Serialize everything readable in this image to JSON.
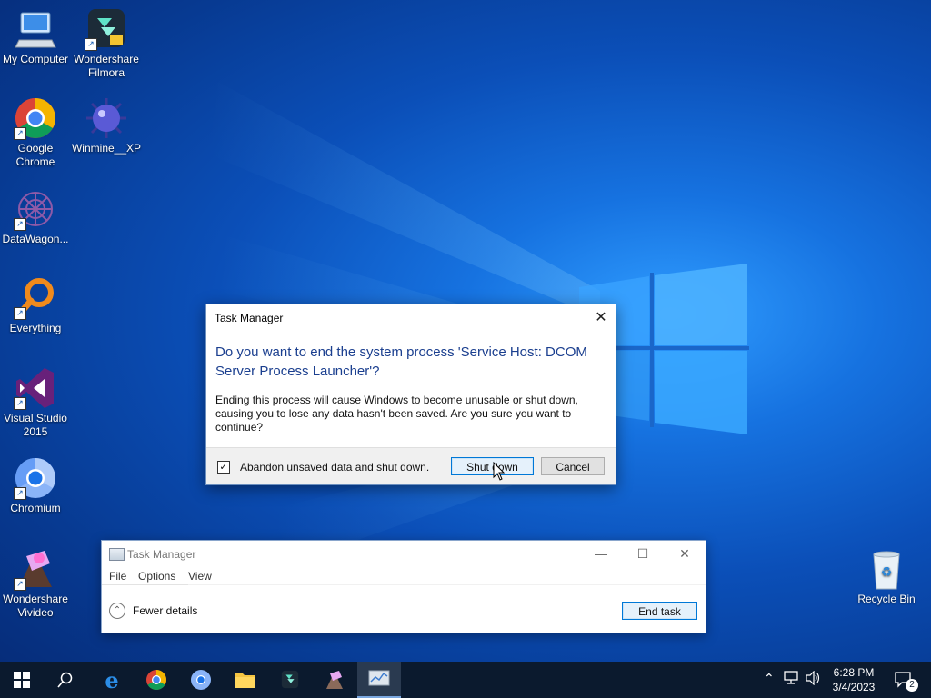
{
  "desktop": {
    "icons": [
      {
        "label": "My Computer",
        "icon": "computer-icon"
      },
      {
        "label": "Wondershare Filmora",
        "icon": "filmora-icon"
      },
      {
        "label": "Google Chrome",
        "icon": "chrome-icon"
      },
      {
        "label": "Winmine__XP",
        "icon": "mine-icon"
      },
      {
        "label": "DataWagon...",
        "icon": "datawagon-icon"
      },
      {
        "label": "Everything",
        "icon": "search-magnifier-icon"
      },
      {
        "label": "Visual Studio 2015",
        "icon": "visual-studio-icon"
      },
      {
        "label": "Chromium",
        "icon": "chromium-icon"
      },
      {
        "label": "Wondershare Vivideo",
        "icon": "vivideo-icon"
      },
      {
        "label": "Recycle Bin",
        "icon": "recycle-bin-icon"
      }
    ]
  },
  "dialog": {
    "title": "Task Manager",
    "question": "Do you want to end the system process 'Service Host: DCOM Server Process Launcher'?",
    "message": "Ending this process will cause Windows to become unusable or shut down, causing you to lose any data hasn't been saved. Are you sure you want to continue?",
    "checkbox_label": "Abandon unsaved data and shut down.",
    "checkbox_checked": true,
    "primary_button": "Shut down",
    "cancel_button": "Cancel",
    "close_glyph": "✕"
  },
  "task_manager": {
    "title": "Task Manager",
    "menu": [
      "File",
      "Options",
      "View"
    ],
    "fewer_details": "Fewer details",
    "end_task": "End task",
    "minimize_glyph": "—",
    "maximize_glyph": "☐",
    "close_glyph": "✕"
  },
  "taskbar": {
    "apps": [
      "start",
      "search",
      "edge",
      "chrome",
      "chromium",
      "file-explorer",
      "filmora",
      "vivideo",
      "task-manager"
    ],
    "active_app": "task-manager",
    "clock_time": "6:28 PM",
    "clock_date": "3/4/2023",
    "notification_count": "2"
  },
  "colors": {
    "accent": "#0078d7",
    "dialog_heading": "#1b3f8f",
    "taskbar": "#0b1a2e"
  }
}
